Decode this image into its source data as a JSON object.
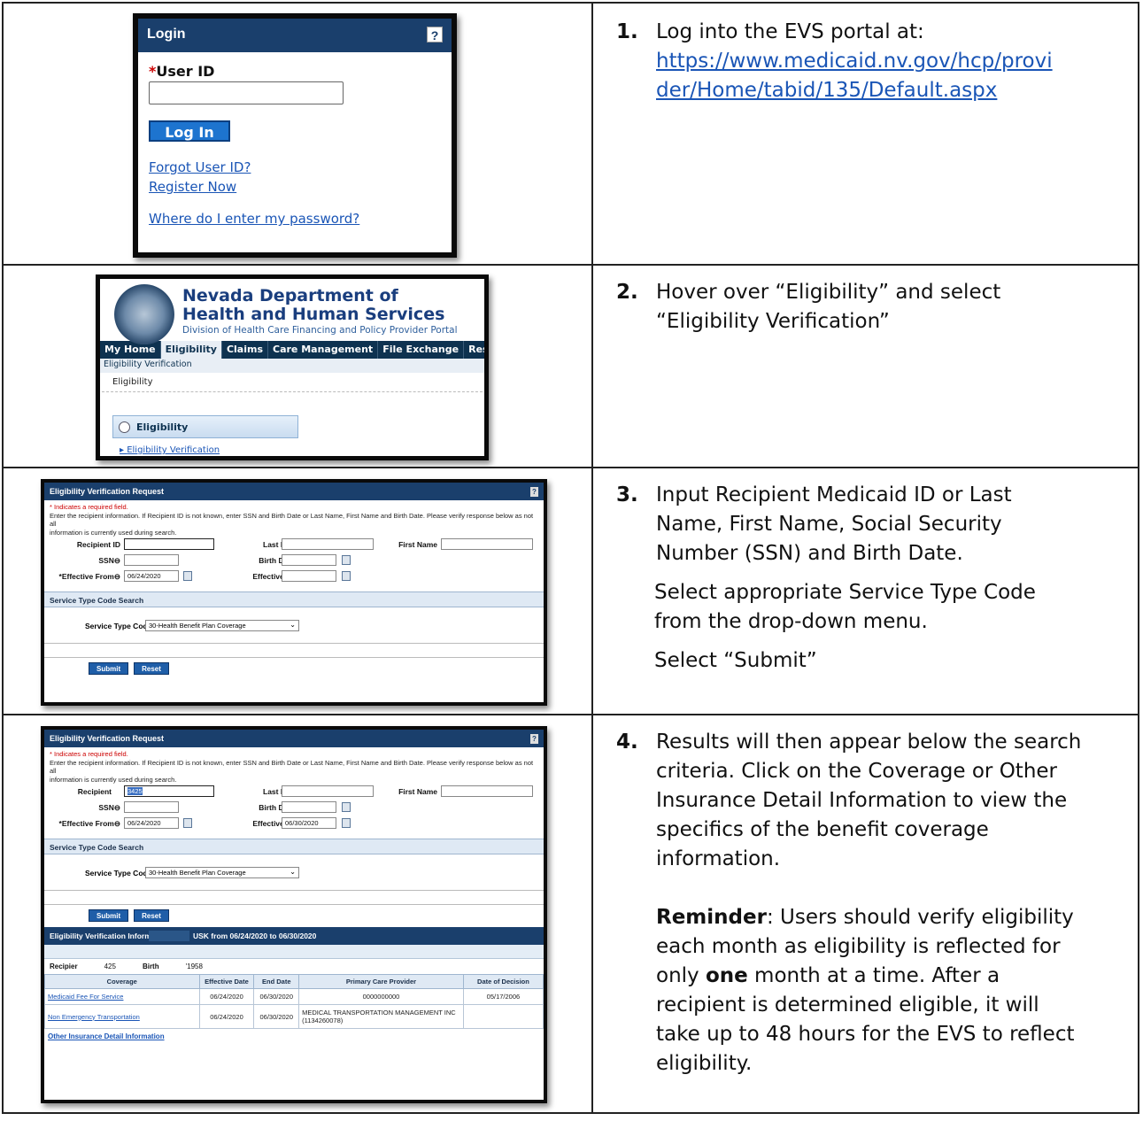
{
  "steps": [
    {
      "num": "1.",
      "text": "Log into the EVS portal at:",
      "link": "https://www.medicaid.nv.gov/hcp/provider/Home/tabid/135/Default.aspx",
      "link_line1": "https://www.medicaid.nv.gov/hcp/provi",
      "link_line2": "der/Home/tabid/135/Default.aspx"
    },
    {
      "num": "2.",
      "line1": "Hover over “Eligibility” and select",
      "line2": "“Eligibility Verification”"
    },
    {
      "num": "3.",
      "line1": "Input Recipient Medicaid ID or Last",
      "line2": "Name, First Name, Social Security",
      "line3": "Number (SSN) and Birth Date.",
      "para2_line1": "Select appropriate Service Type Code",
      "para2_line2": "from the drop-down menu.",
      "para3": "Select “Submit”"
    },
    {
      "num": "4.",
      "line1": "Results will then appear below the search",
      "line2": "criteria.  Click on the Coverage or Other",
      "line3": "Insurance Detail Information to view the",
      "line4": "specifics of the benefit coverage",
      "line5": "information.",
      "reminder_label": "Reminder",
      "rem_line1": ":  Users should verify eligibility",
      "rem_line2": "each month as eligibility is reflected for",
      "rem_line3a": "only ",
      "rem_line3b": "one",
      "rem_line3c": " month at a time.  After a",
      "rem_line4": "recipient is determined eligible, it will",
      "rem_line5": "take up to 48 hours for the EVS to reflect",
      "rem_line6": "eligibility."
    }
  ],
  "login": {
    "title": "Login",
    "help": "?",
    "required_mark": "*",
    "user_id_label": "User ID",
    "login_button": "Log In",
    "forgot": "Forgot User ID?",
    "register": "Register Now",
    "password_q": "Where do I enter my password?"
  },
  "nevada": {
    "title1": "Nevada Department of",
    "title2": "Health and Human Services",
    "subtitle": "Division of Health Care Financing and Policy Provider Portal",
    "nav": [
      "My Home",
      "Eligibility",
      "Claims",
      "Care Management",
      "File Exchange",
      "Resources"
    ],
    "sub_menu": "Eligibility Verification",
    "breadcrumb": "Eligibility",
    "panel": "Eligibility",
    "panel_link": "Eligibility Verification"
  },
  "evform": {
    "title": "Eligibility Verification Request",
    "help": "?",
    "note1": "* Indicates a required field.",
    "note2": "Enter the recipient information. If Recipient ID is not known, enter SSN and Birth Date or Last Name, First Name and Birth Date. Please verify response below as not all",
    "note3": "information is currently used during search.",
    "recipient_id": "Recipient ID",
    "recipient": "Recipient",
    "last_name": "Last Name",
    "first_name": "First Name",
    "ssn": "SSN",
    "birth_date": "Birth Date",
    "effective_from": "*Effective From",
    "effective_to": "Effective To",
    "from_value": "06/24/2020",
    "to_value_4": "06/30/2020",
    "recipient_value_4": "3425",
    "stc_section": "Service Type Code Search",
    "stc_label": "Service Type Code",
    "stc_value": "30-Health Benefit Plan Coverage",
    "submit": "Submit",
    "reset": "Reset"
  },
  "results": {
    "header_a": "Eligibility Verification Informatic",
    "header_b": "USK from 06/24/2020 to 06/30/2020",
    "recip_label": "Recipier",
    "recip_value": "425",
    "birth_label": "Birth",
    "birth_value": "'1958",
    "columns": [
      "Coverage",
      "Effective Date",
      "End Date",
      "Primary Care Provider",
      "Date of Decision"
    ],
    "rows": [
      [
        "Medicaid Fee For Service",
        "06/24/2020",
        "06/30/2020",
        "0000000000",
        "05/17/2006"
      ],
      [
        "Non Emergency Transportation",
        "06/24/2020",
        "06/30/2020",
        "MEDICAL TRANSPORTATION MANAGEMENT INC (1134260078)",
        ""
      ]
    ],
    "other_link": "Other Insurance Detail Information"
  }
}
